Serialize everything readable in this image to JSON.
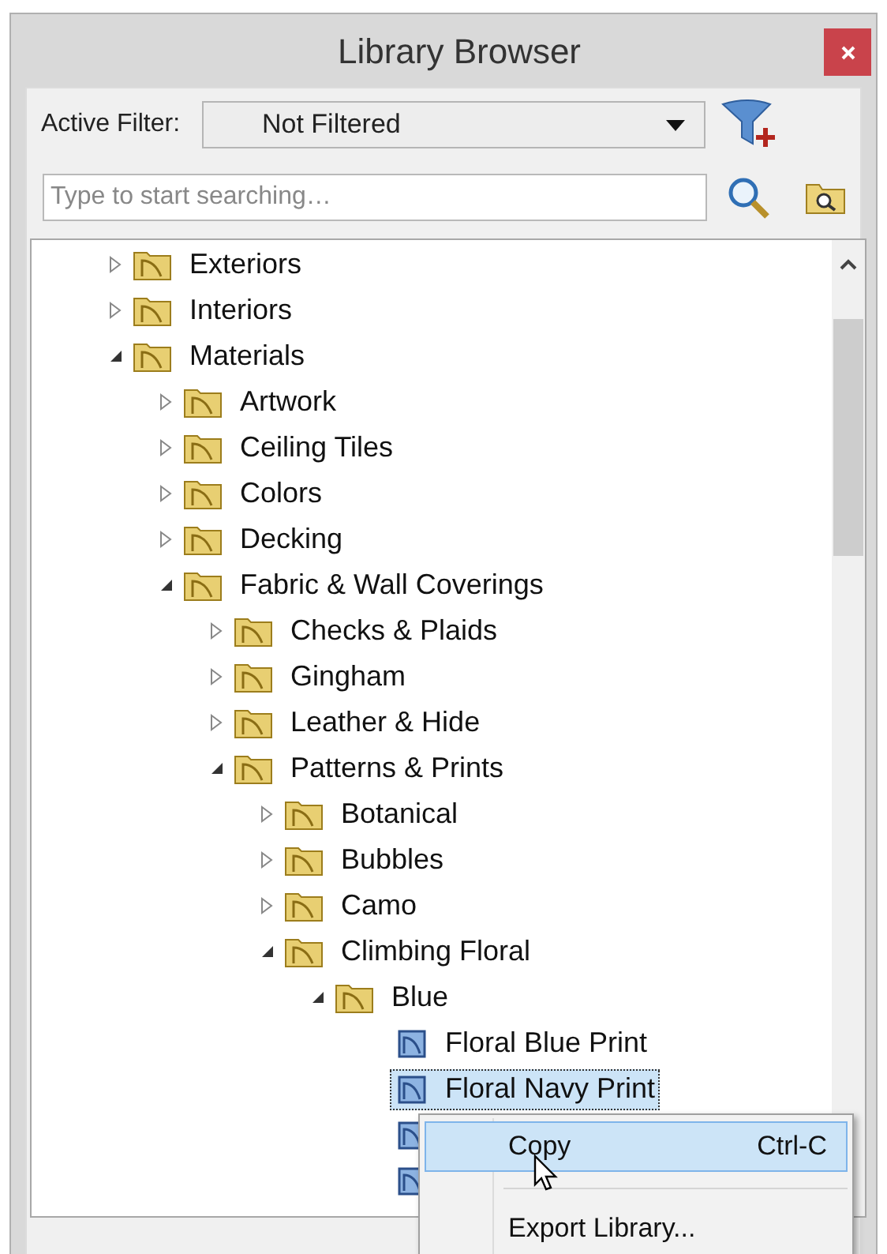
{
  "window": {
    "title": "Library Browser"
  },
  "filter": {
    "label": "Active Filter:",
    "value": "Not Filtered"
  },
  "search": {
    "placeholder": "Type to start searching…"
  },
  "tree": [
    {
      "kind": "folder",
      "label": "Exteriors",
      "expanded": false
    },
    {
      "kind": "folder",
      "label": "Interiors",
      "expanded": false
    },
    {
      "kind": "folder",
      "label": "Materials",
      "expanded": true,
      "children": [
        {
          "kind": "folder",
          "label": "Artwork",
          "expanded": false
        },
        {
          "kind": "folder",
          "label": "Ceiling Tiles",
          "expanded": false
        },
        {
          "kind": "folder",
          "label": "Colors",
          "expanded": false
        },
        {
          "kind": "folder",
          "label": "Decking",
          "expanded": false
        },
        {
          "kind": "folder",
          "label": "Fabric & Wall Coverings",
          "expanded": true,
          "children": [
            {
              "kind": "folder",
              "label": "Checks & Plaids",
              "expanded": false
            },
            {
              "kind": "folder",
              "label": "Gingham",
              "expanded": false
            },
            {
              "kind": "folder",
              "label": "Leather & Hide",
              "expanded": false
            },
            {
              "kind": "folder",
              "label": "Patterns & Prints",
              "expanded": true,
              "children": [
                {
                  "kind": "folder",
                  "label": "Botanical",
                  "expanded": false
                },
                {
                  "kind": "folder",
                  "label": "Bubbles",
                  "expanded": false
                },
                {
                  "kind": "folder",
                  "label": "Camo",
                  "expanded": false
                },
                {
                  "kind": "folder",
                  "label": "Climbing Floral",
                  "expanded": true,
                  "children": [
                    {
                      "kind": "folder",
                      "label": "Blue",
                      "expanded": true,
                      "children": [
                        {
                          "kind": "file",
                          "label": "Floral Blue Print",
                          "selected": false
                        },
                        {
                          "kind": "file",
                          "label": "Floral Navy Print",
                          "selected": true
                        },
                        {
                          "kind": "file",
                          "selected": false
                        },
                        {
                          "kind": "file",
                          "selected": false
                        }
                      ]
                    }
                  ]
                }
              ]
            }
          ]
        }
      ]
    }
  ],
  "context_menu": [
    {
      "label": "Copy",
      "shortcut": "Ctrl-C",
      "selected": true
    },
    {
      "label": "Export Library...",
      "selected": false
    }
  ]
}
